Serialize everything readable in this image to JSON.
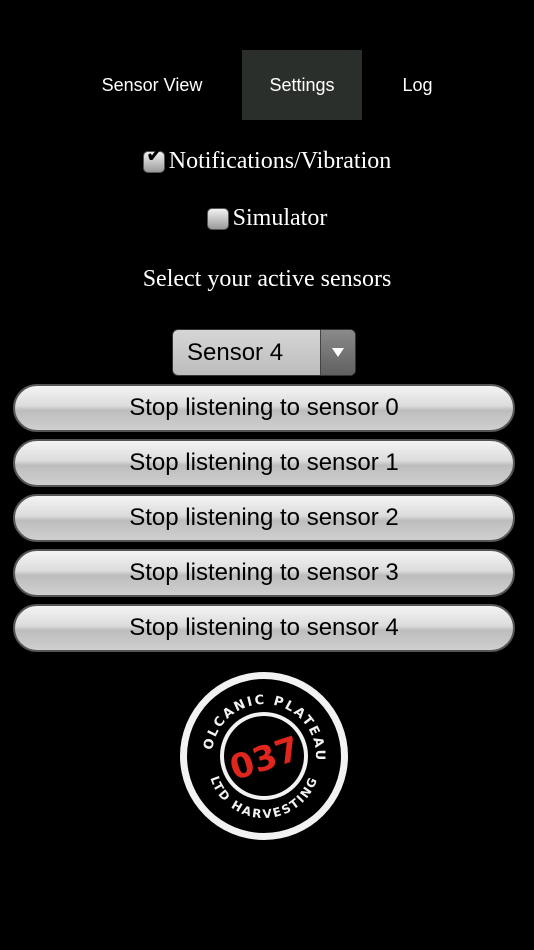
{
  "tabs": [
    {
      "label": "Sensor View",
      "active": false
    },
    {
      "label": "Settings",
      "active": true
    },
    {
      "label": "Log",
      "active": false
    }
  ],
  "settings": {
    "notifications": {
      "label": "Notifications/Vibration",
      "checked": true
    },
    "simulator": {
      "label": "Simulator",
      "checked": false
    },
    "select_label": "Select your active sensors",
    "sensor_select": {
      "selected": "Sensor 4"
    }
  },
  "buttons": [
    {
      "label": "Stop listening to sensor 0"
    },
    {
      "label": "Stop listening to sensor 1"
    },
    {
      "label": "Stop listening to sensor 2"
    },
    {
      "label": "Stop listening to sensor 3"
    },
    {
      "label": "Stop listening to sensor 4"
    }
  ],
  "logo": {
    "center_text": "037",
    "ring_text_top": "VOLCANIC PLATEAU",
    "ring_text_bottom": "LTD HARVESTING",
    "accent_color": "#e0261c"
  },
  "colors": {
    "background": "#000000",
    "active_tab": "#2b2f2b"
  }
}
